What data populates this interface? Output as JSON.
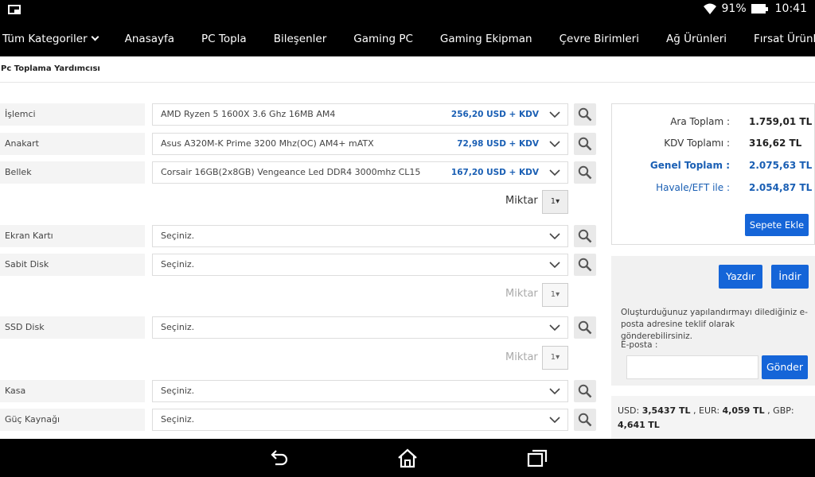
{
  "status_bar": {
    "battery": "91%",
    "time": "10:41"
  },
  "nav": {
    "items": [
      "Tüm Kategoriler",
      "Anasayfa",
      "PC Topla",
      "Bileşenler",
      "Gaming PC",
      "Gaming Ekipman",
      "Çevre Birimleri",
      "Ağ Ürünleri",
      "Fırsat Ürünleri"
    ]
  },
  "page": {
    "title": "Pc Toplama Yardımcısı"
  },
  "components": [
    {
      "label": "İşlemci",
      "value": "AMD Ryzen 5 1600X 3.6 Ghz 16MB AM4",
      "price": "256,20 USD + KDV"
    },
    {
      "label": "Anakart",
      "value": "Asus A320M-K Prime 3200 Mhz(OC) AM4+ mATX",
      "price": "72,98 USD + KDV"
    },
    {
      "label": "Bellek",
      "value": "Corsair 16GB(2x8GB) Vengeance Led DDR4 3000mhz CL15",
      "price": "167,20 USD + KDV"
    },
    {
      "label": "Ekran Kartı",
      "value": "Seçiniz.",
      "price": ""
    },
    {
      "label": "Sabit Disk",
      "value": "Seçiniz.",
      "price": ""
    },
    {
      "label": "SSD Disk",
      "value": "Seçiniz.",
      "price": ""
    },
    {
      "label": "Kasa",
      "value": "Seçiniz.",
      "price": ""
    },
    {
      "label": "Güç Kaynağı",
      "value": "Seçiniz.",
      "price": ""
    }
  ],
  "quantity": {
    "label": "Miktar :",
    "value": "1▾"
  },
  "totals": {
    "subtotal_label": "Ara Toplam :",
    "subtotal": "1.759,01 TL",
    "vat_label": "KDV Toplamı :",
    "vat": "316,62 TL",
    "grand_label": "Genel Toplam :",
    "grand": "2.075,63 TL",
    "eft_label": "Havale/EFT ile :",
    "eft": "2.054,87 TL",
    "add_to_cart": "Sepete Ekle"
  },
  "actions": {
    "print": "Yazdır",
    "download": "İndir",
    "info": "Oluşturduğunuz yapılandırmayı dilediğiniz e-posta adresine teklif olarak gönderebilirsiniz.",
    "email_label": "E-posta :",
    "send": "Gönder"
  },
  "currency": {
    "usd_label": "USD:",
    "usd": "3,5437 TL",
    "eur_label": ", EUR:",
    "eur": "4,059 TL",
    "gbp_label": ", GBP:",
    "gbp": "4,641",
    "gbp_unit": "TL"
  },
  "colors": {
    "accent": "#1565d8",
    "price_blue": "#1a5fb4",
    "bar": "#000000"
  }
}
